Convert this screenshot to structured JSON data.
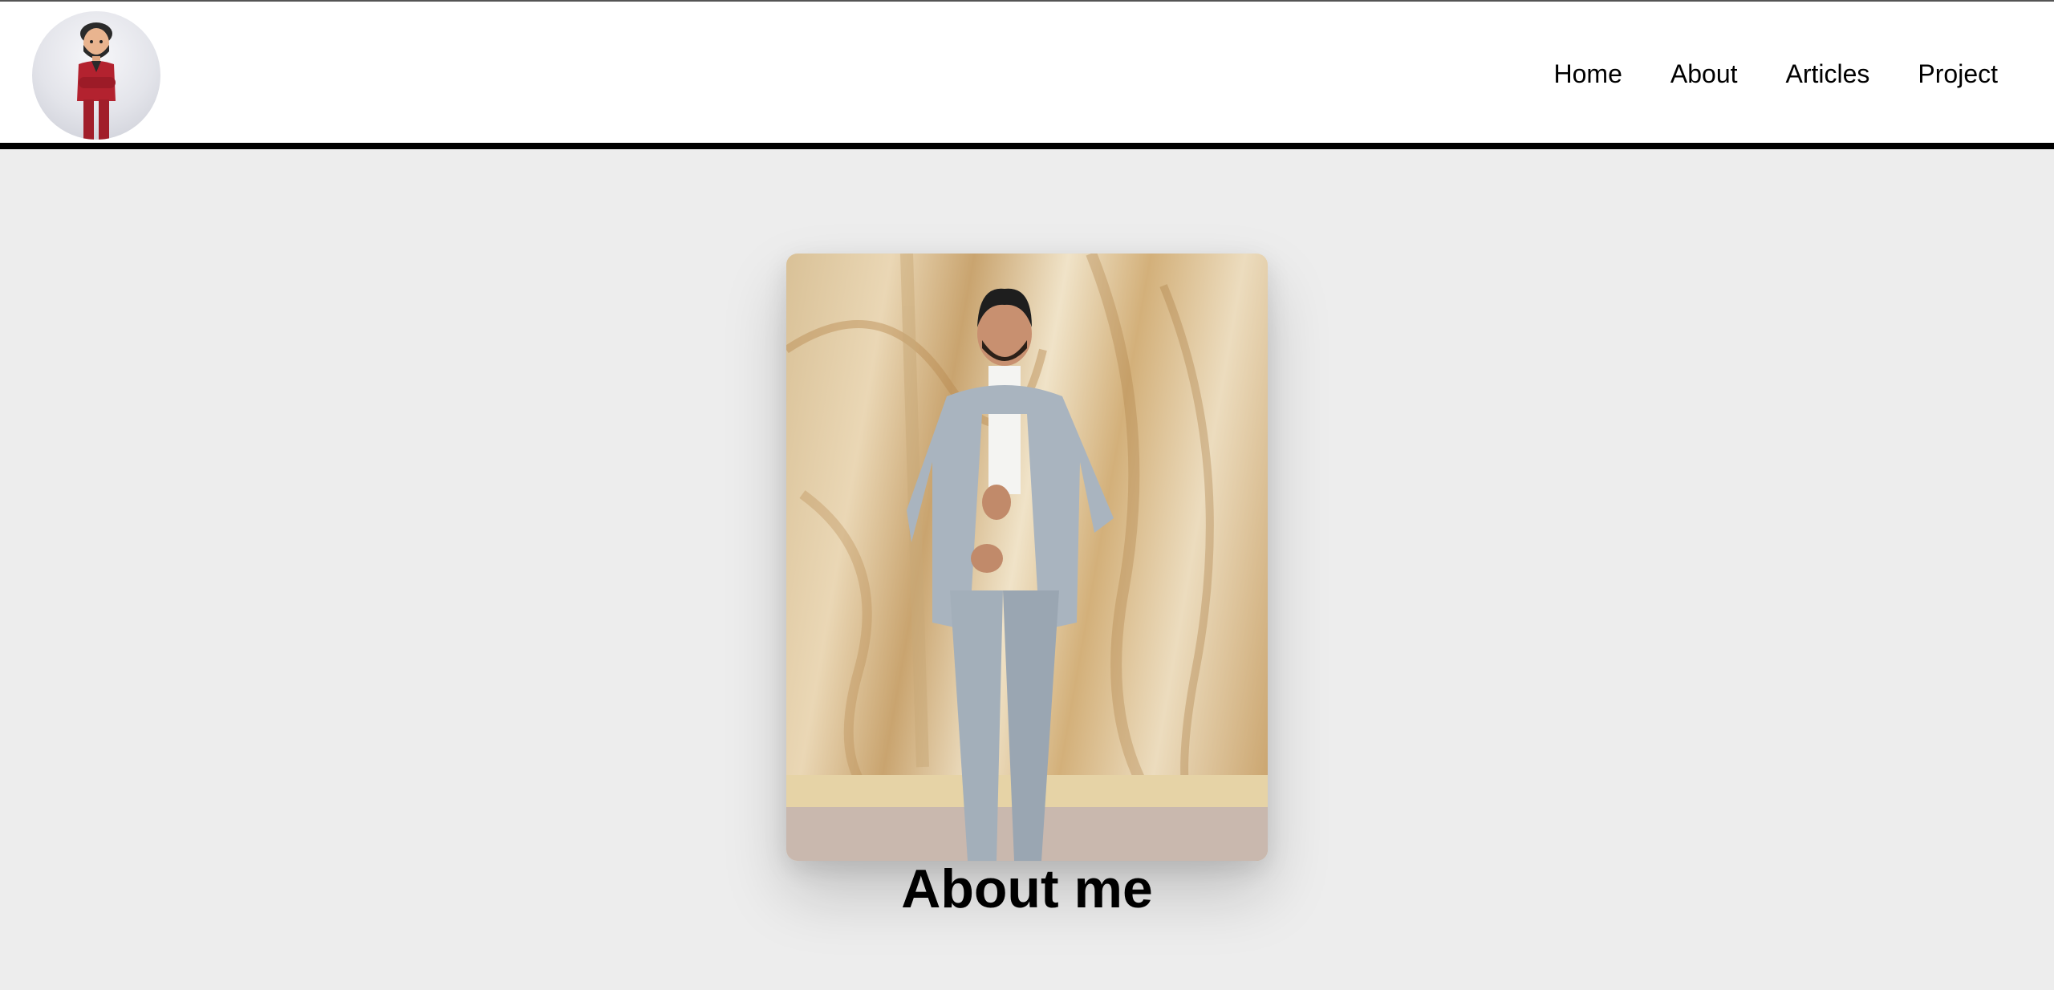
{
  "header": {
    "avatar_alt": "Cartoon avatar of a man in a red suit",
    "nav": [
      {
        "label": "Home"
      },
      {
        "label": "About"
      },
      {
        "label": "Articles"
      },
      {
        "label": "Project"
      }
    ]
  },
  "main": {
    "photo_alt": "Man in a light grey suit standing in front of a carved marble relief",
    "title": "About me"
  }
}
